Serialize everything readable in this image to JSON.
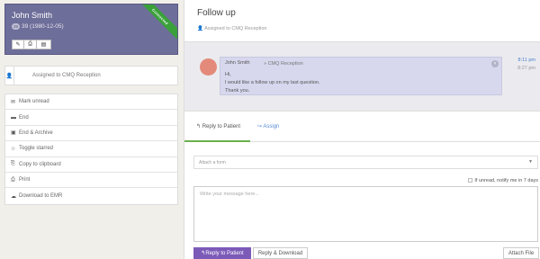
{
  "patient": {
    "name": "John Smith",
    "badge": "39",
    "age_dob": "39 (1980-12-05)",
    "ribbon": "Connected"
  },
  "left_panel": {
    "assigned_label": "Assigned to CMQ Reception",
    "actions": [
      {
        "label": "Mark unread",
        "icon": "envelope-icon"
      },
      {
        "label": "End",
        "icon": "box-icon"
      },
      {
        "label": "End & Archive",
        "icon": "archive-icon"
      },
      {
        "label": "Toggle starred",
        "icon": "star-icon"
      },
      {
        "label": "Copy to clipboard",
        "icon": "copy-icon"
      },
      {
        "label": "Print",
        "icon": "print-icon"
      },
      {
        "label": "Download to EMR",
        "icon": "cloud-download-icon"
      }
    ]
  },
  "conversation": {
    "title": "Follow up",
    "subtitle": "Assigned to CMQ Reception",
    "message": {
      "from": "John Smith",
      "to": "» CMQ Reception",
      "lines": [
        "Hi,",
        "I would like a follow up on my last question.",
        "Thank you."
      ],
      "time_sent": "8:11 pm",
      "time_read": "8:27 pm"
    }
  },
  "compose": {
    "tab_reply": "Reply to Patient",
    "tab_assign": "Assign",
    "attach_form_placeholder": "Attach a form",
    "notify_label": "If unread, notify me in 7 days",
    "message_placeholder": "Write your message here...",
    "reply_button": "Reply to Patient",
    "reply_download_button": "Reply & Download",
    "attach_file_button": "Attach File"
  },
  "colors": {
    "card": "#6e6e9a",
    "ribbon": "#3aa13a",
    "primary_button": "#7c5ab8",
    "link": "#4b7fc9",
    "active_tab": "#6ab04c"
  }
}
